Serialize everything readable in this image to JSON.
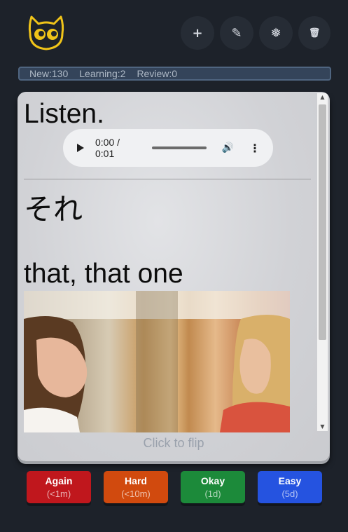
{
  "toolbar": {
    "add_icon": "+",
    "edit_icon": "✎",
    "settings_icon": "❅",
    "delete_icon": "🗑"
  },
  "stats": {
    "new": "New:130",
    "learning": "Learning:2",
    "review": "Review:0"
  },
  "card": {
    "prompt": "Listen.",
    "audio_time": "0:00 / 0:01",
    "kana": "それ",
    "meaning": "that, that one",
    "flip_hint": "Click to flip"
  },
  "answers": [
    {
      "label": "Again",
      "interval": "(<1m)",
      "color": "#c0171d"
    },
    {
      "label": "Hard",
      "interval": "(<10m)",
      "color": "#d14a0e"
    },
    {
      "label": "Okay",
      "interval": "(1d)",
      "color": "#1c8a3a"
    },
    {
      "label": "Easy",
      "interval": "(5d)",
      "color": "#2553e0"
    }
  ],
  "colors": {
    "background": "#1d222a",
    "logo_yellow": "#f0c419"
  }
}
